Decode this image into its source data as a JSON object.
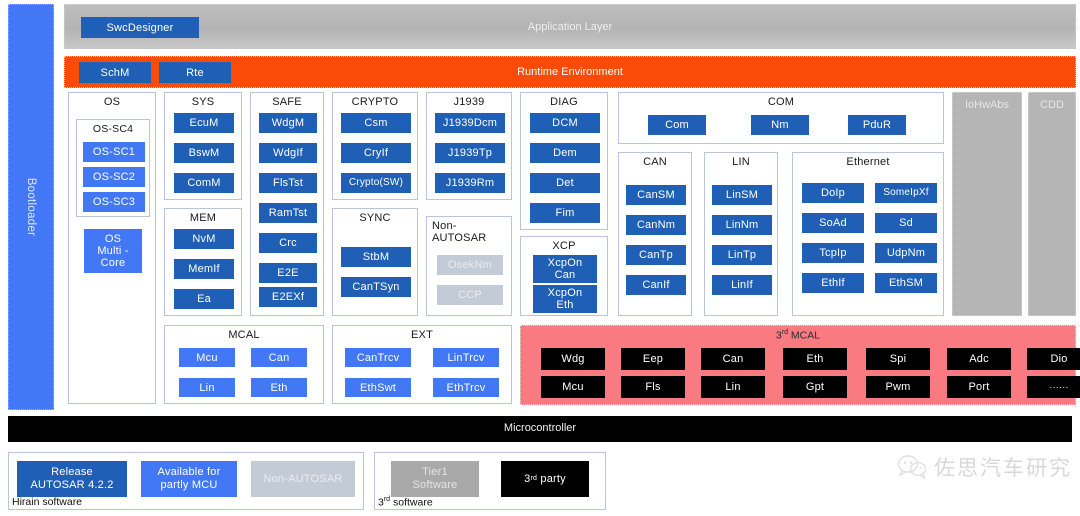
{
  "colors": {
    "dark_blue": "#1f5fb5",
    "light_blue": "#4277f5",
    "orange": "#fa4b08",
    "pink": "#fa7a82",
    "gray_panel": "#b5b5b5",
    "gray_chip": "#c3cbd6",
    "black": "#000000",
    "tier_gray": "#a9a9a9"
  },
  "bootloader": {
    "label": "Bootloader"
  },
  "application_layer": {
    "caption": "Application Layer",
    "chips": [
      {
        "label": "SwcDesigner",
        "style": "dark"
      }
    ]
  },
  "rte": {
    "caption": "Runtime Environment",
    "chips": [
      {
        "label": "SchM",
        "style": "dark"
      },
      {
        "label": "Rte",
        "style": "dark"
      }
    ]
  },
  "bsw_groups": [
    {
      "name": "OS",
      "sub": {
        "name": "OS-SC4",
        "chips": [
          {
            "label": "OS-SC1",
            "style": "light"
          },
          {
            "label": "OS-SC2",
            "style": "light"
          },
          {
            "label": "OS-SC3",
            "style": "light"
          }
        ]
      },
      "chips": [
        {
          "label": "OS\nMulti -\nCore",
          "style": "light"
        }
      ]
    },
    {
      "name": "SYS",
      "chips": [
        {
          "label": "EcuM",
          "style": "dark"
        },
        {
          "label": "BswM",
          "style": "dark"
        },
        {
          "label": "ComM",
          "style": "dark"
        }
      ]
    },
    {
      "name": "MEM",
      "chips": [
        {
          "label": "NvM",
          "style": "dark"
        },
        {
          "label": "MemIf",
          "style": "dark"
        },
        {
          "label": "Ea",
          "style": "dark"
        }
      ]
    },
    {
      "name": "SAFE",
      "chips": [
        {
          "label": "WdgM",
          "style": "dark"
        },
        {
          "label": "WdgIf",
          "style": "dark"
        },
        {
          "label": "FlsTst",
          "style": "dark"
        },
        {
          "label": "RamTst",
          "style": "dark"
        },
        {
          "label": "Crc",
          "style": "dark"
        },
        {
          "label": "E2E",
          "style": "dark"
        },
        {
          "label": "E2EXf",
          "style": "dark"
        }
      ]
    },
    {
      "name": "CRYPTO",
      "chips": [
        {
          "label": "Csm",
          "style": "dark"
        },
        {
          "label": "CryIf",
          "style": "dark"
        },
        {
          "label": "Crypto(SW)",
          "style": "dark"
        }
      ]
    },
    {
      "name": "SYNC",
      "chips": [
        {
          "label": "StbM",
          "style": "dark"
        },
        {
          "label": "CanTSyn",
          "style": "dark"
        }
      ]
    },
    {
      "name": "J1939",
      "chips": [
        {
          "label": "J1939Dcm",
          "style": "dark"
        },
        {
          "label": "J1939Tp",
          "style": "dark"
        },
        {
          "label": "J1939Rm",
          "style": "dark"
        }
      ]
    },
    {
      "name": "Non-AUTOSAR",
      "chips": [
        {
          "label": "OsekNm",
          "style": "gray"
        },
        {
          "label": "CCP",
          "style": "gray"
        }
      ]
    },
    {
      "name": "DIAG",
      "chips": [
        {
          "label": "DCM",
          "style": "dark"
        },
        {
          "label": "Dem",
          "style": "dark"
        },
        {
          "label": "Det",
          "style": "dark"
        },
        {
          "label": "Fim",
          "style": "dark"
        }
      ]
    },
    {
      "name": "XCP",
      "chips": [
        {
          "label": "XcpOn\nCan",
          "style": "dark"
        },
        {
          "label": "XcpOn\nEth",
          "style": "dark"
        }
      ]
    },
    {
      "name": "COM",
      "chips": [
        {
          "label": "Com",
          "style": "dark"
        },
        {
          "label": "Nm",
          "style": "dark"
        },
        {
          "label": "PduR",
          "style": "dark"
        }
      ]
    },
    {
      "name": "CAN",
      "chips": [
        {
          "label": "CanSM",
          "style": "dark"
        },
        {
          "label": "CanNm",
          "style": "dark"
        },
        {
          "label": "CanTp",
          "style": "dark"
        },
        {
          "label": "CanIf",
          "style": "dark"
        }
      ]
    },
    {
      "name": "LIN",
      "chips": [
        {
          "label": "LinSM",
          "style": "dark"
        },
        {
          "label": "LinNm",
          "style": "dark"
        },
        {
          "label": "LinTp",
          "style": "dark"
        },
        {
          "label": "LinIf",
          "style": "dark"
        }
      ]
    },
    {
      "name": "Ethernet",
      "chips": [
        {
          "label": "DoIp",
          "style": "dark"
        },
        {
          "label": "SomeIpXf",
          "style": "dark"
        },
        {
          "label": "SoAd",
          "style": "dark"
        },
        {
          "label": "Sd",
          "style": "dark"
        },
        {
          "label": "TcpIp",
          "style": "dark"
        },
        {
          "label": "UdpNm",
          "style": "dark"
        },
        {
          "label": "EthIf",
          "style": "dark"
        },
        {
          "label": "EthSM",
          "style": "dark"
        }
      ]
    },
    {
      "name": "MCAL",
      "chips": [
        {
          "label": "Mcu",
          "style": "light"
        },
        {
          "label": "Can",
          "style": "light"
        },
        {
          "label": "Lin",
          "style": "light"
        },
        {
          "label": "Eth",
          "style": "light"
        }
      ]
    },
    {
      "name": "EXT",
      "chips": [
        {
          "label": "CanTrcv",
          "style": "light"
        },
        {
          "label": "LinTrcv",
          "style": "light"
        },
        {
          "label": "EthSwt",
          "style": "light"
        },
        {
          "label": "EthTrcv",
          "style": "light"
        }
      ]
    }
  ],
  "gray_columns": [
    {
      "label": "IoHwAbs"
    },
    {
      "label": "CDD"
    }
  ],
  "mcal3": {
    "caption_main": "MCAL",
    "caption_prefix": "3",
    "caption_sup": "rd",
    "chips": [
      [
        "Wdg",
        "Mcu"
      ],
      [
        "Eep",
        "Fls"
      ],
      [
        "Can",
        "Lin"
      ],
      [
        "Eth",
        "Gpt"
      ],
      [
        "Spi",
        "Pwm"
      ],
      [
        "Adc",
        "Port"
      ],
      [
        "Dio",
        "······"
      ]
    ]
  },
  "microcontroller": {
    "caption": "Microcontroller"
  },
  "legend": {
    "left": {
      "caption": "Hirain software",
      "items": [
        {
          "label": "Release\nAUTOSAR  4.2.2",
          "style": "dark"
        },
        {
          "label": "Available for\npartly MCU",
          "style": "light"
        },
        {
          "label": "Non-AUTOSAR",
          "style": "gray"
        }
      ]
    },
    "right": {
      "caption_prefix": "3",
      "caption_sup": "rd",
      "caption_main": "software",
      "items": [
        {
          "label": "Tier1\nSoftware",
          "style": "tier"
        },
        {
          "label_prefix": "3",
          "label_sup": "rd",
          "label_main": "party",
          "style": "black"
        }
      ]
    }
  },
  "watermark": {
    "text": "佐思汽车研究",
    "icon": "wechat-icon"
  }
}
